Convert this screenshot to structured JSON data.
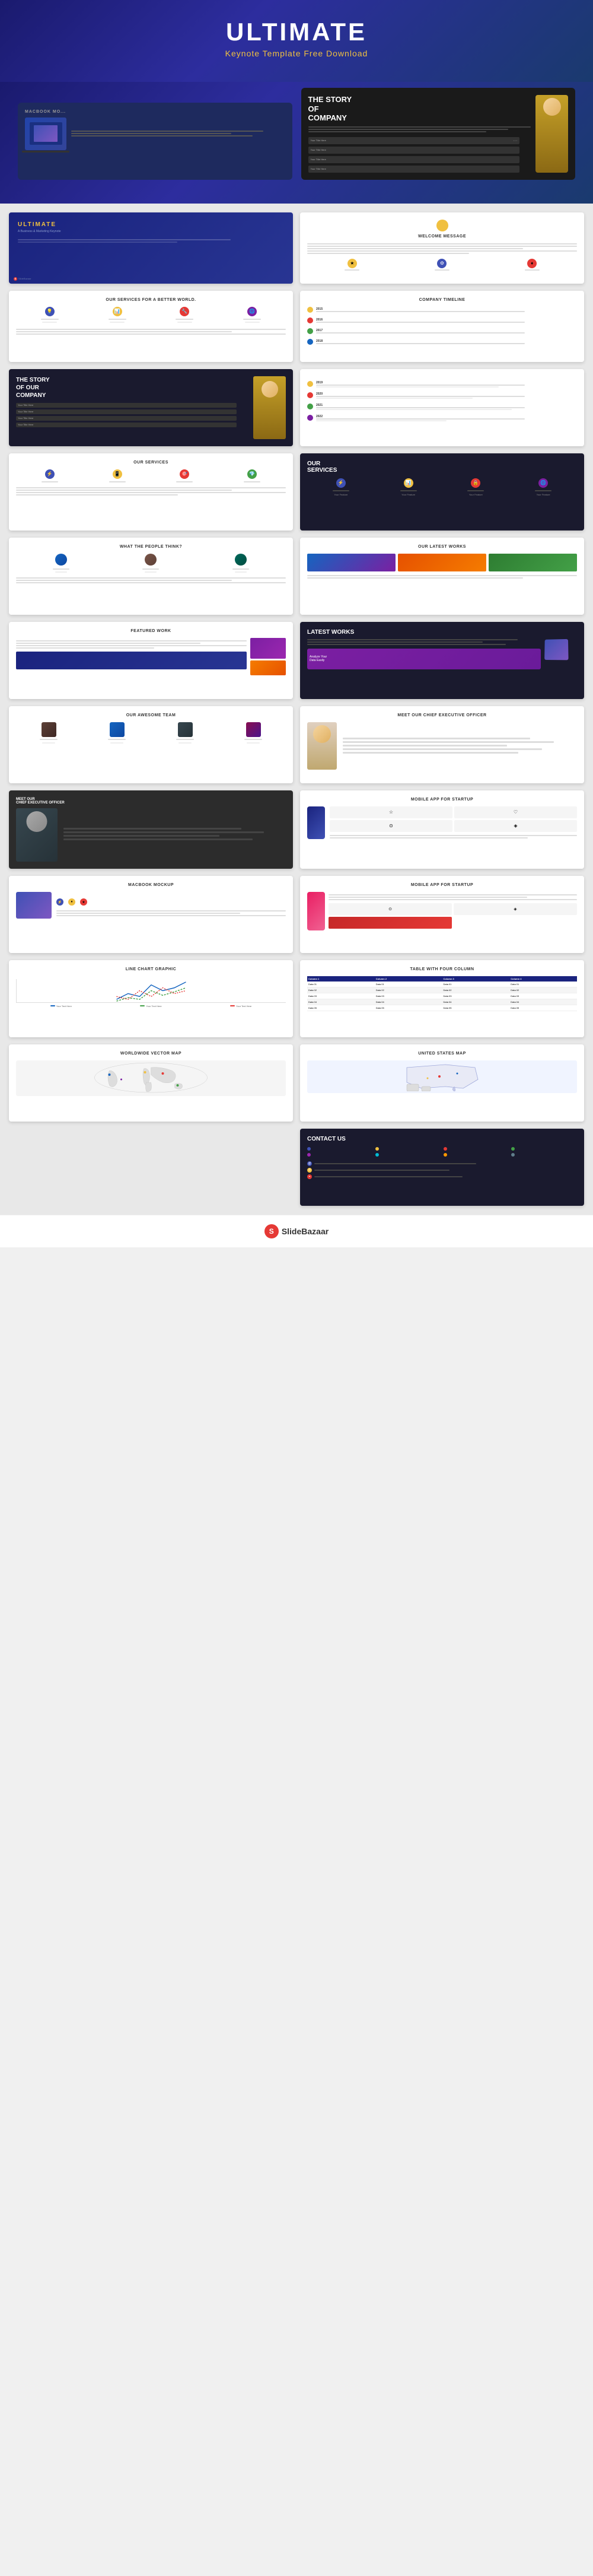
{
  "header": {
    "title": "ULTIMATE",
    "subtitle": "Keynote Template Free Download"
  },
  "slides": [
    {
      "id": "slide-ultimate",
      "type": "ultimate",
      "logo": "ULTIMATE",
      "sub": "A Business & Marketing Keynote Template"
    },
    {
      "id": "slide-welcome",
      "type": "welcome",
      "title": "WELCOME MESSAGE"
    },
    {
      "id": "slide-services-light",
      "type": "services-light",
      "title": "Our Services For A Better World."
    },
    {
      "id": "slide-timeline",
      "type": "timeline",
      "title": "COMPANY TIMELINE"
    },
    {
      "id": "slide-story",
      "type": "story-dark",
      "title": "THE STORY OF OUR COMPANY"
    },
    {
      "id": "slide-timeline2",
      "type": "timeline2",
      "title": ""
    },
    {
      "id": "slide-our-services",
      "type": "our-services-light",
      "title": "OUR SERVICES"
    },
    {
      "id": "slide-our-services-dark",
      "type": "our-services-dark",
      "title": "OUR SERVICES"
    },
    {
      "id": "slide-what-people",
      "type": "what-people",
      "title": "WHAT THE PEOPLE THINK?"
    },
    {
      "id": "slide-latest-works-light",
      "type": "latest-works-light",
      "title": "OUR LATEST WORKS"
    },
    {
      "id": "slide-featured",
      "type": "featured",
      "title": "FEATURED WORK"
    },
    {
      "id": "slide-latest-dark",
      "type": "latest-dark",
      "title": "LATEST WORKS"
    },
    {
      "id": "slide-team",
      "type": "team",
      "title": "OUR AWESOME TEAM"
    },
    {
      "id": "slide-ceo-light",
      "type": "ceo-light",
      "title": "MEET OUR CHIEF EXECUTIVE OFFICER"
    },
    {
      "id": "slide-ceo-dark",
      "type": "ceo-dark",
      "title": "MEET OUR CHIEF EXECUTIVE OFFICER"
    },
    {
      "id": "slide-mobile",
      "type": "mobile",
      "title": "MOBILE APP FOR STARTUP"
    },
    {
      "id": "slide-macbook",
      "type": "macbook",
      "title": "MACBOOK MOCKUP"
    },
    {
      "id": "slide-mobile-full",
      "type": "mobile-full",
      "title": "MOBILE APP FOR STARTUP"
    },
    {
      "id": "slide-chart",
      "type": "chart",
      "title": "LINE CHART GRAPHIC"
    },
    {
      "id": "slide-table",
      "type": "table",
      "title": "TABLE WITH FOUR COLUMN"
    },
    {
      "id": "slide-worldmap",
      "type": "worldmap",
      "title": "WORLDWIDE VECTOR MAP"
    },
    {
      "id": "slide-usmap",
      "type": "usmap",
      "title": "UNITED STATES MAP"
    },
    {
      "id": "slide-contact",
      "type": "contact",
      "title": "CONTACT US"
    }
  ],
  "footer": {
    "brand": "SlideBazaar",
    "icon_letter": "S"
  }
}
